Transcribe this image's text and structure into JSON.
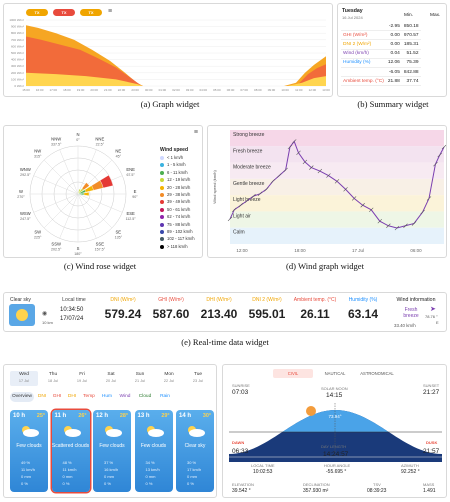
{
  "graph_widget": {
    "pills": [
      "TX",
      "TX",
      "TX"
    ],
    "y_ticks": [
      "1000 W/m²",
      "900 W/m²",
      "800 W/m²",
      "700 W/m²",
      "600 W/m²",
      "500 W/m²",
      "400 W/m²",
      "300 W/m²",
      "200 W/m²",
      "100 W/m²",
      "0 W/m²"
    ],
    "x_ticks": [
      "15:00",
      "16:00",
      "17:00",
      "18:00",
      "19:00",
      "20:00",
      "21:00",
      "22:00",
      "23:00",
      "00:00",
      "01:00",
      "02:00",
      "03:00",
      "04:00",
      "05:00",
      "06:00",
      "07:00",
      "08:00",
      "09:00",
      "10:00",
      "11:00",
      "12:00",
      "13:00"
    ],
    "caption": "(a) Graph widget"
  },
  "summary_widget": {
    "day": "Tuesday",
    "date": "16 Jul 2024",
    "col_min": "Min.",
    "col_max": "Max.",
    "rows": [
      {
        "label": "",
        "min": "-2.95",
        "max": "850.18",
        "color": "#333333"
      },
      {
        "label": "GHI (W/m²)",
        "min": "0.00",
        "max": "970.57",
        "color": "#e84b3c"
      },
      {
        "label": "DNI 2 (W/m²)",
        "min": "0.00",
        "max": "185.31",
        "color": "#f0a500"
      },
      {
        "label": "Wind (km/h)",
        "min": "0.04",
        "max": "51.52",
        "color": "#7b3fb0"
      },
      {
        "label": "Humidity (%)",
        "min": "12.06",
        "max": "75.39",
        "color": "#1e90ff"
      },
      {
        "label": "",
        "min": "-6.05",
        "max": "842.88",
        "color": "#333333"
      },
      {
        "label": "Ambient temp. (°C)",
        "min": "21.88",
        "max": "37.74",
        "color": "#e84b3c"
      }
    ],
    "caption": "(b) Summary widget"
  },
  "wind_rose": {
    "title": "Wind speed",
    "legend": [
      "< 1 km/h",
      "1 - 5 km/h",
      "6 - 11 km/h",
      "12 - 19 km/h",
      "20 - 28 km/h",
      "29 - 38 km/h",
      "39 - 49 km/h",
      "50 - 61 km/h",
      "62 - 74 km/h",
      "75 - 88 km/h",
      "89 - 102 km/h",
      "102 - 117 km/h",
      "> 118 km/h"
    ],
    "legend_colors": [
      "#cfd8ff",
      "#3bb3e0",
      "#4caf50",
      "#c6d93a",
      "#f4b400",
      "#f28c28",
      "#e53935",
      "#c2185b",
      "#8e24aa",
      "#5e35b1",
      "#3949ab",
      "#455a64",
      "#000000"
    ],
    "directions": [
      {
        "n": "N",
        "deg": "0°"
      },
      {
        "n": "NNE",
        "deg": "22.5°"
      },
      {
        "n": "NE",
        "deg": "45°"
      },
      {
        "n": "ENE",
        "deg": "67.5°"
      },
      {
        "n": "E",
        "deg": "90°"
      },
      {
        "n": "ESE",
        "deg": "112.5°"
      },
      {
        "n": "SE",
        "deg": "135°"
      },
      {
        "n": "SSE",
        "deg": "157.5°"
      },
      {
        "n": "S",
        "deg": "180°"
      },
      {
        "n": "SSW",
        "deg": "202.5°"
      },
      {
        "n": "SW",
        "deg": "225°"
      },
      {
        "n": "WSW",
        "deg": "247.5°"
      },
      {
        "n": "W",
        "deg": "270°"
      },
      {
        "n": "WNW",
        "deg": "292.5°"
      },
      {
        "n": "NW",
        "deg": "315°"
      },
      {
        "n": "NNW",
        "deg": "337.5°"
      }
    ],
    "caption": "(c) Wind rose widget"
  },
  "wind_graph": {
    "bands": [
      "Strong breeze",
      "Fresh breeze",
      "Moderate breeze",
      "Gentle breeze",
      "Light breeze",
      "Light air",
      "Calm"
    ],
    "band_colors": [
      "#f6d7e8",
      "#f3e3f0",
      "#f7eaf2",
      "#f8f0e6",
      "#fbf3d9",
      "#eef6e6",
      "#e6f2fb"
    ],
    "ylabel": "Wind speed (km/h)",
    "x_ticks": [
      "12:00",
      "18:00",
      "17 Jul",
      "06:00"
    ],
    "caption": "(d) Wind graph widget"
  },
  "realtime": {
    "sky": "Clear sky",
    "wind_small": "10 km",
    "local_time_label": "Local time",
    "local_time": "10:34:50",
    "local_date": "17/07/24",
    "items": [
      {
        "label": "DNI (W/m²)",
        "value": "579.24",
        "color": "#f0a500"
      },
      {
        "label": "GHI (W/m²)",
        "value": "587.60",
        "color": "#e84b3c"
      },
      {
        "label": "DHI (W/m²)",
        "value": "213.40",
        "color": "#f0a500"
      },
      {
        "label": "DNI 2 (W/m²)",
        "value": "595.01",
        "color": "#f0a500"
      },
      {
        "label": "Ambient temp. (°C)",
        "value": "26.11",
        "color": "#e84b3c"
      },
      {
        "label": "Humidity (%)",
        "value": "63.14",
        "color": "#1e90ff"
      }
    ],
    "wind_info_label": "Wind information",
    "wind_info_class": "Fresh breeze",
    "wind_info_speed": "33.40 km/h",
    "wind_info_dir": "78.76 °",
    "wind_info_dir2": "E",
    "caption": "(e) Real-time data widget"
  },
  "forecast": {
    "days": [
      {
        "d": "Wed",
        "date": "17 Jul"
      },
      {
        "d": "Thu",
        "date": "18 Jul"
      },
      {
        "d": "Fri",
        "date": "19 Jul"
      },
      {
        "d": "Sat",
        "date": "20 Jul"
      },
      {
        "d": "Sun",
        "date": "21 Jul"
      },
      {
        "d": "Mon",
        "date": "22 Jul"
      },
      {
        "d": "Tue",
        "date": "23 Jul"
      }
    ],
    "pills": [
      {
        "t": "Overview",
        "c": "#333333",
        "bg": "#e4ebf5"
      },
      {
        "t": "DNI",
        "c": "#f0a500",
        "bg": "#ffffff"
      },
      {
        "t": "GHI",
        "c": "#e84b3c",
        "bg": "#ffffff"
      },
      {
        "t": "DHI",
        "c": "#f0a500",
        "bg": "#ffffff"
      },
      {
        "t": "Temp",
        "c": "#e84b3c",
        "bg": "#ffffff"
      },
      {
        "t": "Hum",
        "c": "#1e90ff",
        "bg": "#ffffff"
      },
      {
        "t": "Wind",
        "c": "#7b3fb0",
        "bg": "#ffffff"
      },
      {
        "t": "Cloud",
        "c": "#2e7d32",
        "bg": "#ffffff"
      },
      {
        "t": "Rain",
        "c": "#1e90ff",
        "bg": "#ffffff"
      }
    ],
    "cards": [
      {
        "h": "10 h",
        "t": "25°",
        "cond": "Few clouds",
        "m": [
          "49 %",
          "11 km/h",
          "0 mm",
          "0 %"
        ]
      },
      {
        "h": "11 h",
        "t": "26°",
        "cond": "Scattered clouds",
        "m": [
          "48 %",
          "11 km/h",
          "0 mm",
          "0 %"
        ]
      },
      {
        "h": "12 h",
        "t": "28°",
        "cond": "Few clouds",
        "m": [
          "37 %",
          "16 km/h",
          "0 mm",
          "0 %"
        ]
      },
      {
        "h": "13 h",
        "t": "29°",
        "cond": "Few clouds",
        "m": [
          "34 %",
          "13 km/h",
          "0 mm",
          "0 %"
        ]
      },
      {
        "h": "14 h",
        "t": "30°",
        "cond": "Clear sky",
        "m": [
          "30 %",
          "17 km/h",
          "0 mm",
          "0 %"
        ]
      }
    ]
  },
  "sun_widget": {
    "tabs": [
      "CIVIL",
      "NAUTICAL",
      "ASTRONOMICAL"
    ],
    "sunrise_label": "SUNRISE",
    "sunrise": "07:03",
    "noon_label": "SOLAR NOON",
    "noon": "14:15",
    "sunset_label": "SUNSET",
    "sunset": "21:27",
    "dawn_label": "DAWN",
    "dawn": "06:33",
    "dusk_label": "DUSK",
    "dusk": "21:57",
    "day_length_label": "DAY LENGTH",
    "day_length": "14:24:57",
    "elev_marker": "73.94°",
    "local_time_label": "LOCAL TIME",
    "local_time": "10:02:53",
    "hour_angle_label": "HOUR ANGLE",
    "hour_angle": "-55.695 °",
    "azimuth_label": "AZIMUTH",
    "azimuth": "92.252 °",
    "elevation_label": "ELEVATION",
    "elevation": "39.542 °",
    "declination_label": "DECLINATION",
    "declination": "357.930 m²",
    "tsv_label": "TSV",
    "tsv": "08:39:23",
    "mass_label": "MASS",
    "mass": "1.491"
  }
}
